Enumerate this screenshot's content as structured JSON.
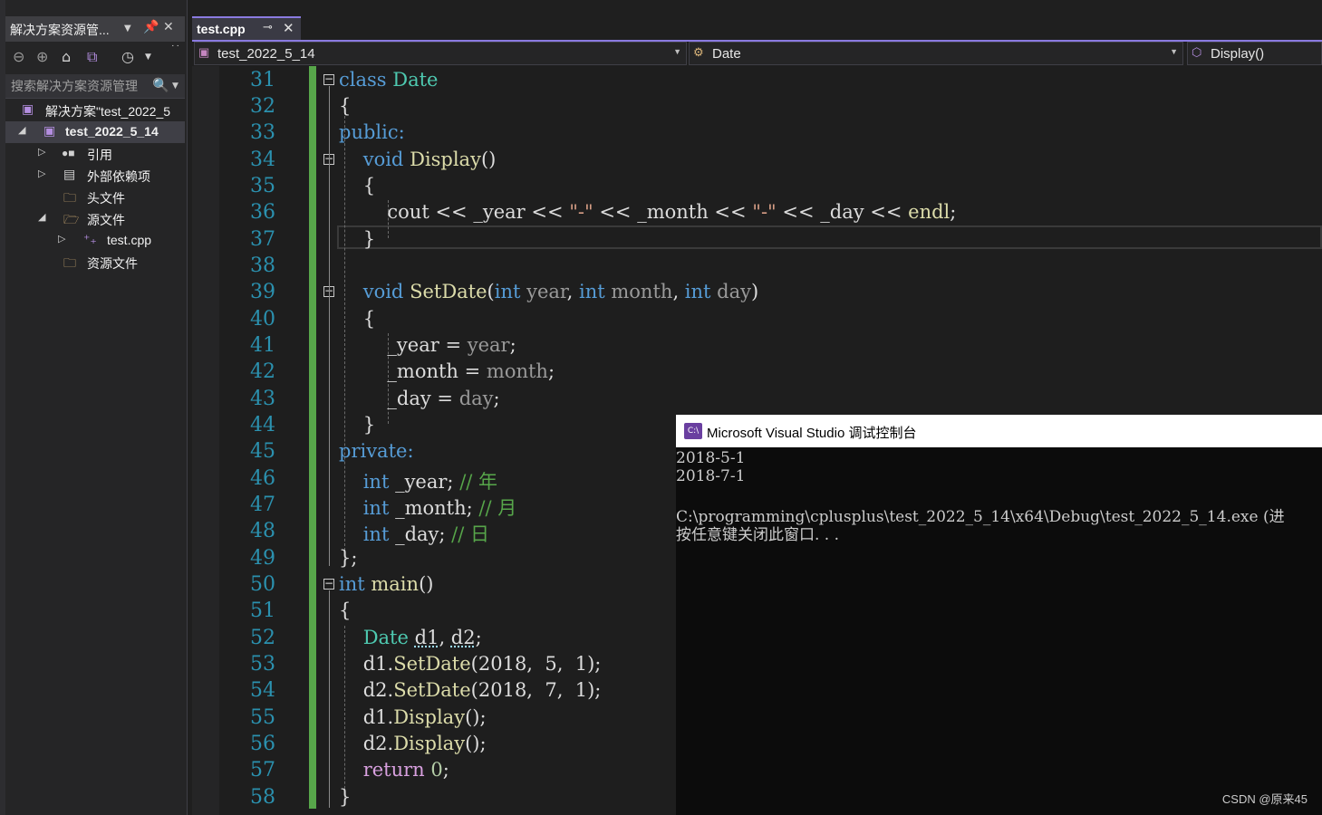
{
  "solution_explorer": {
    "title": "解决方案资源管...",
    "search_placeholder": "搜索解决方案资源管理",
    "tree": [
      {
        "label": "解决方案\"test_2022_5",
        "icon": "solution-icon",
        "indent": 0
      },
      {
        "label": "test_2022_5_14",
        "icon": "project-icon",
        "indent": 1,
        "selected": true,
        "expanded": true
      },
      {
        "label": "引用",
        "icon": "references-icon",
        "indent": 2
      },
      {
        "label": "外部依赖项",
        "icon": "external-deps-icon",
        "indent": 2
      },
      {
        "label": "头文件",
        "icon": "folder-icon",
        "indent": 2
      },
      {
        "label": "源文件",
        "icon": "folder-open-icon",
        "indent": 2,
        "expanded": true
      },
      {
        "label": "test.cpp",
        "icon": "cpp-file-icon",
        "indent": 3
      },
      {
        "label": "资源文件",
        "icon": "folder-icon",
        "indent": 2
      }
    ]
  },
  "editor": {
    "tab_label": "test.cpp",
    "nav_project": "test_2022_5_14",
    "nav_class": "Date",
    "nav_member": "Display()",
    "line_numbers": [
      "31",
      "32",
      "33",
      "34",
      "35",
      "36",
      "37",
      "38",
      "39",
      "40",
      "41",
      "42",
      "43",
      "44",
      "45",
      "46",
      "47",
      "48",
      "49",
      "50",
      "51",
      "52",
      "53",
      "54",
      "55",
      "56",
      "57",
      "58"
    ],
    "code": {
      "l31": {
        "kw": "class",
        "name": "Date"
      },
      "l32": "{",
      "l33": "public:",
      "l34": {
        "kw": "void",
        "fn": "Display",
        "rest": "()"
      },
      "l35": "{",
      "l36": {
        "a": "cout << ",
        "b": "_year",
        "c": " << ",
        "s1": "\"-\"",
        "d": " << ",
        "e": "_month",
        "f": " << ",
        "s2": "\"-\"",
        "g": " << ",
        "h": "_day",
        "i": " << ",
        "j": "endl",
        "k": ";"
      },
      "l37": "}",
      "l39": {
        "kw": "void",
        "fn": "SetDate",
        "p1": "(",
        "t1": "int",
        "a1": " year",
        "c1": ", ",
        "t2": "int",
        "a2": " month",
        "c2": ", ",
        "t3": "int",
        "a3": " day",
        "p2": ")"
      },
      "l40": "{",
      "l41": {
        "m": "_year",
        "op": " = ",
        "p": "year",
        "e": ";"
      },
      "l42": {
        "m": "_month",
        "op": " = ",
        "p": "month",
        "e": ";"
      },
      "l43": {
        "m": "_day",
        "op": " = ",
        "p": "day",
        "e": ";"
      },
      "l44": "}",
      "l45": "private:",
      "l46": {
        "t": "int",
        "m": " _year",
        "e": "; ",
        "c": "// 年"
      },
      "l47": {
        "t": "int",
        "m": " _month",
        "e": "; ",
        "c": "// 月"
      },
      "l48": {
        "t": "int",
        "m": " _day",
        "e": "; ",
        "c": "// 日"
      },
      "l49": "};",
      "l50": {
        "t": "int",
        "fn": "main",
        "rest": "()"
      },
      "l51": "{",
      "l52": {
        "ty": "Date",
        "sp": " ",
        "v1": "d1",
        "c": ", ",
        "v2": "d2",
        "e": ";"
      },
      "l53": {
        "v": "d1.",
        "fn": "SetDate",
        "args": "(2018,  5,  1);"
      },
      "l54": {
        "v": "d2.",
        "fn": "SetDate",
        "args": "(2018,  7,  1);"
      },
      "l55": {
        "v": "d1.",
        "fn": "Display",
        "args": "();"
      },
      "l56": {
        "v": "d2.",
        "fn": "Display",
        "args": "();"
      },
      "l57": {
        "kw": "return",
        "num": " 0",
        "e": ";"
      },
      "l58": "}"
    }
  },
  "console": {
    "title": "Microsoft Visual Studio 调试控制台",
    "icon_text": "C:\\",
    "lines": [
      "2018-5-1",
      "2018-7-1",
      "",
      "C:\\programming\\cplusplus\\test_2022_5_14\\x64\\Debug\\test_2022_5_14.exe (进",
      "按任意键关闭此窗口. . ."
    ]
  },
  "watermark": "CSDN @原来45",
  "colors": {
    "keyword": "#569cd6",
    "type": "#4ec9b0",
    "function": "#dcdcaa",
    "comment": "#57a64a",
    "string": "#d69d85",
    "line_number": "#2b91af",
    "accent": "#8a7ae0"
  }
}
